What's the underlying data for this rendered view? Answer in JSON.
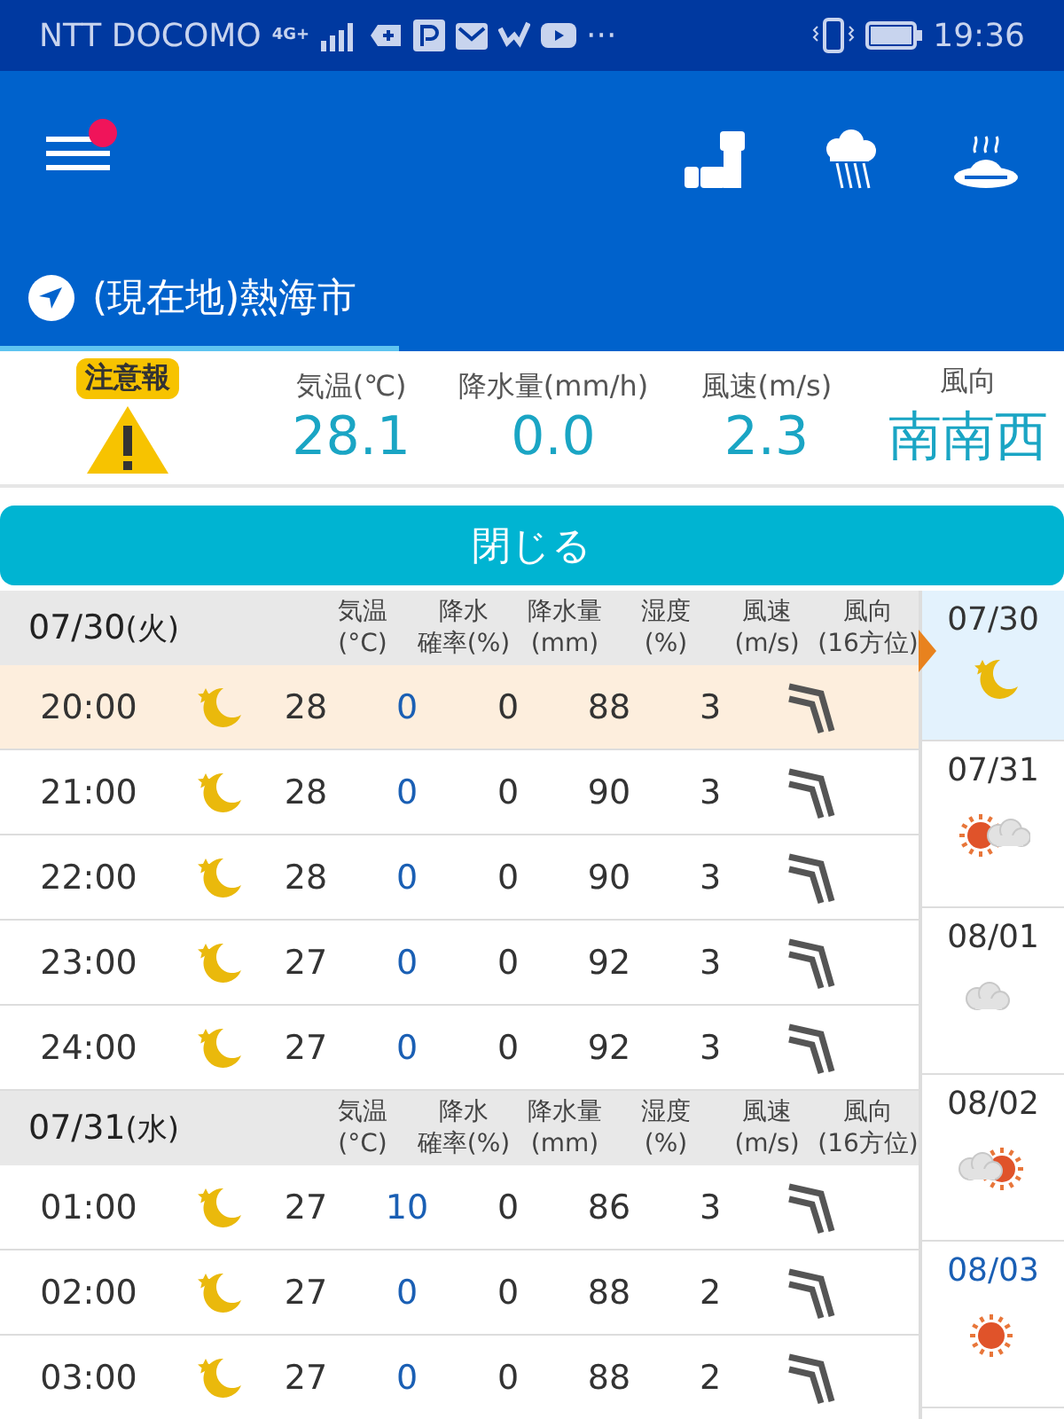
{
  "status_bar": {
    "carrier": "NTT DOCOMO",
    "network": "4G+",
    "more": "···",
    "time": "19:36"
  },
  "app_bar": {
    "menu_badge": true
  },
  "location": {
    "label": "(現在地)熱海市"
  },
  "summary": {
    "alert": "注意報",
    "fields": [
      {
        "label": "気温(℃)",
        "value": "28.1"
      },
      {
        "label": "降水量(mm/h)",
        "value": "0.0"
      },
      {
        "label": "風速(m/s)",
        "value": "2.3"
      },
      {
        "label": "風向",
        "value": "南南西"
      }
    ]
  },
  "close_button": "閉じる",
  "hourly": {
    "sections": [
      {
        "date": "07/30",
        "weekday": "(火)",
        "columns": [
          {
            "line1": "気温",
            "line2": "(°C)"
          },
          {
            "line1": "降水",
            "line2": "確率(%)"
          },
          {
            "line1": "降水量",
            "line2": "(mm)"
          },
          {
            "line1": "湿度",
            "line2": "(%)"
          },
          {
            "line1": "風速",
            "line2": "(m/s)"
          },
          {
            "line1": "風向",
            "line2": "(16方位)"
          }
        ],
        "rows": [
          {
            "time": "20:00",
            "kind": "moon",
            "temp": "28",
            "prob": "0",
            "amount": "0",
            "humidity": "88",
            "speed": "3",
            "selected": true
          },
          {
            "time": "21:00",
            "kind": "moon",
            "temp": "28",
            "prob": "0",
            "amount": "0",
            "humidity": "90",
            "speed": "3",
            "selected": false
          },
          {
            "time": "22:00",
            "kind": "moon",
            "temp": "28",
            "prob": "0",
            "amount": "0",
            "humidity": "90",
            "speed": "3",
            "selected": false
          },
          {
            "time": "23:00",
            "kind": "moon",
            "temp": "27",
            "prob": "0",
            "amount": "0",
            "humidity": "92",
            "speed": "3",
            "selected": false
          },
          {
            "time": "24:00",
            "kind": "moon",
            "temp": "27",
            "prob": "0",
            "amount": "0",
            "humidity": "92",
            "speed": "3",
            "selected": false
          }
        ]
      },
      {
        "date": "07/31",
        "weekday": "(水)",
        "columns": [
          {
            "line1": "気温",
            "line2": "(°C)"
          },
          {
            "line1": "降水",
            "line2": "確率(%)"
          },
          {
            "line1": "降水量",
            "line2": "(mm)"
          },
          {
            "line1": "湿度",
            "line2": "(%)"
          },
          {
            "line1": "風速",
            "line2": "(m/s)"
          },
          {
            "line1": "風向",
            "line2": "(16方位)"
          }
        ],
        "rows": [
          {
            "time": "01:00",
            "kind": "moon",
            "temp": "27",
            "prob": "10",
            "amount": "0",
            "humidity": "86",
            "speed": "3",
            "selected": false
          },
          {
            "time": "02:00",
            "kind": "moon",
            "temp": "27",
            "prob": "0",
            "amount": "0",
            "humidity": "88",
            "speed": "2",
            "selected": false
          },
          {
            "time": "03:00",
            "kind": "moon",
            "temp": "27",
            "prob": "0",
            "amount": "0",
            "humidity": "88",
            "speed": "2",
            "selected": false
          }
        ]
      }
    ]
  },
  "days": [
    {
      "date": "07/30",
      "kind": "moon",
      "selected": true,
      "color": "#333333"
    },
    {
      "date": "07/31",
      "kind": "sun-cloud",
      "selected": false,
      "color": "#333333"
    },
    {
      "date": "08/01",
      "kind": "cloud",
      "selected": false,
      "color": "#333333"
    },
    {
      "date": "08/02",
      "kind": "cloud-sun",
      "selected": false,
      "color": "#333333"
    },
    {
      "date": "08/03",
      "kind": "sun",
      "selected": false,
      "color": "#1a5fb4"
    }
  ]
}
